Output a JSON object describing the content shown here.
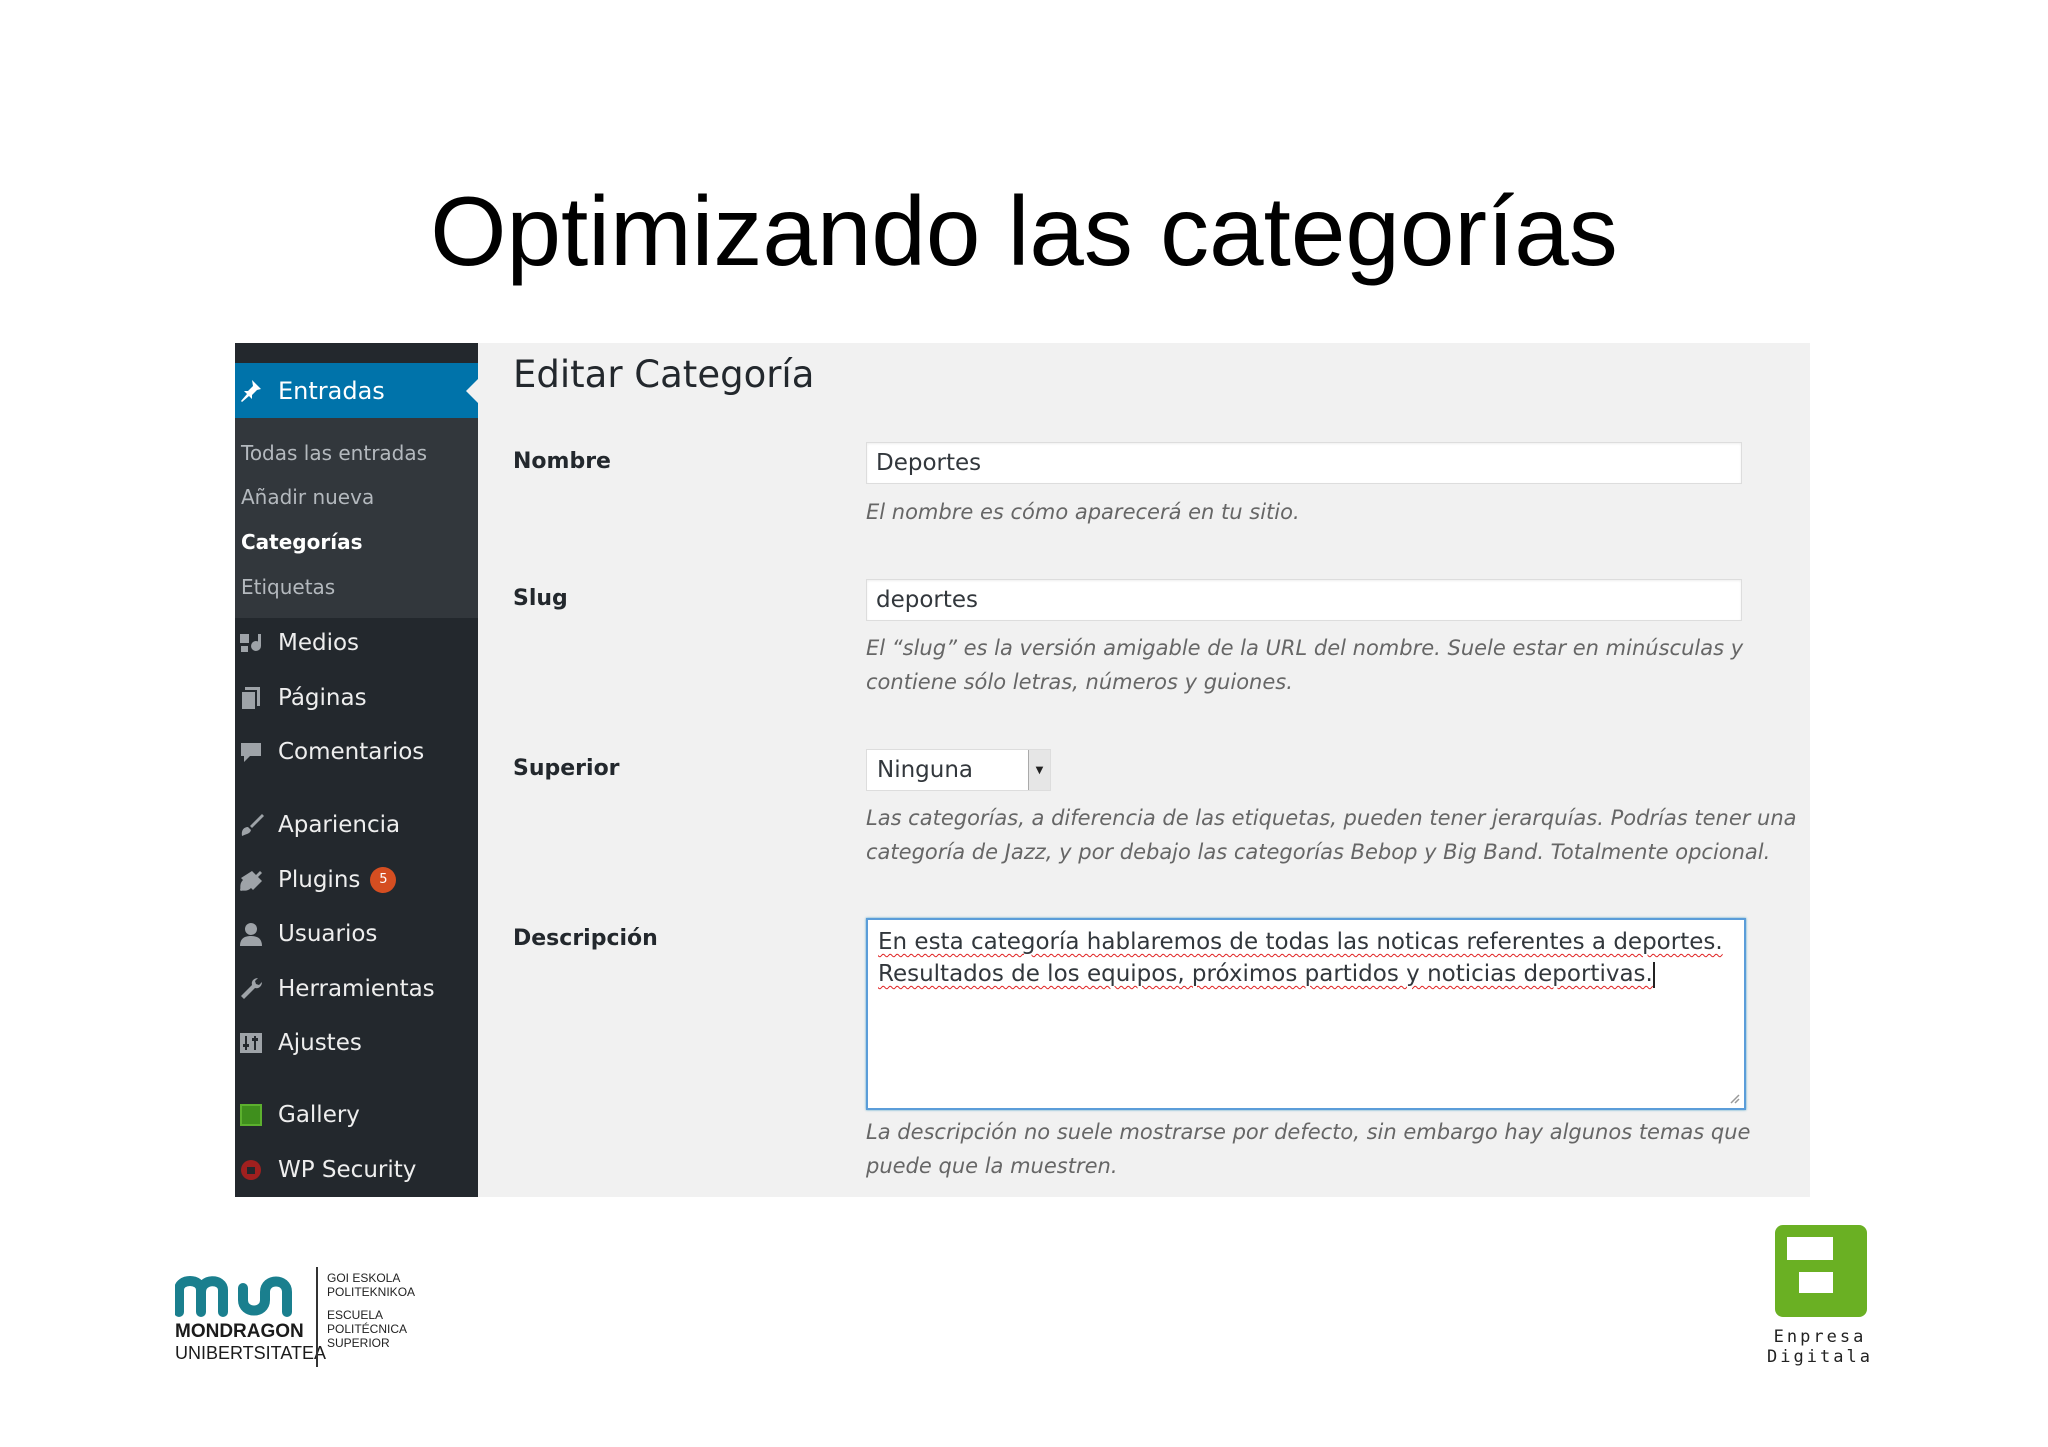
{
  "slide": {
    "title": "Optimizando las categorías"
  },
  "sidebar": {
    "active": {
      "label": "Entradas",
      "icon": "pin-icon"
    },
    "submenu": [
      {
        "label": "Todas las entradas",
        "current": false
      },
      {
        "label": "Añadir nueva",
        "current": false
      },
      {
        "label": "Categorías",
        "current": true
      },
      {
        "label": "Etiquetas",
        "current": false
      }
    ],
    "items": [
      {
        "label": "Medios",
        "icon": "media-icon"
      },
      {
        "label": "Páginas",
        "icon": "pages-icon"
      },
      {
        "label": "Comentarios",
        "icon": "comments-icon"
      },
      {
        "label": "Apariencia",
        "icon": "appearance-icon"
      },
      {
        "label": "Plugins",
        "icon": "plugins-icon",
        "badge": "5"
      },
      {
        "label": "Usuarios",
        "icon": "users-icon"
      },
      {
        "label": "Herramientas",
        "icon": "tools-icon"
      },
      {
        "label": "Ajustes",
        "icon": "settings-icon"
      },
      {
        "label": "Gallery",
        "icon": "gallery-icon"
      },
      {
        "label": "WP Security",
        "icon": "security-icon"
      }
    ],
    "colors": {
      "bg": "#23282d",
      "submenu_bg": "#32373c",
      "active_bg": "#0073aa",
      "badge": "#d54e21"
    }
  },
  "form": {
    "page_title": "Editar Categoría",
    "nombre": {
      "label": "Nombre",
      "value": "Deportes",
      "help": "El nombre es cómo aparecerá en tu sitio."
    },
    "slug": {
      "label": "Slug",
      "value": "deportes",
      "help": "El “slug” es la versión amigable de la URL del nombre. Suele estar en minúsculas y contiene sólo letras, números y guiones."
    },
    "superior": {
      "label": "Superior",
      "value": "Ninguna",
      "help": "Las categorías, a diferencia de las etiquetas, pueden tener jerarquías. Podrías tener una categoría de Jazz, y por debajo las categorías Bebop y Big Band. Totalmente opcional."
    },
    "descripcion": {
      "label": "Descripción",
      "line1": "En esta categoría hablaremos de todas las noticas referentes a deportes.",
      "line2": "Resultados de los equipos, próximos partidos y noticias deportivas.",
      "help": "La descripción no suele mostrarse por defecto, sin embargo hay algunos temas que puede que la muestren."
    }
  },
  "footer": {
    "mondragon": {
      "line1": "MONDRAGON",
      "line2": "UNIBERTSITATEA",
      "side1": "GOI ESKOLA",
      "side2": "POLITEKNIKOA",
      "side3": "ESCUELA",
      "side4": "POLITÉCNICA",
      "side5": "SUPERIOR",
      "color": "#1a7f8e"
    },
    "enpresa": {
      "line1": "Enpresa",
      "line2": "Digitala",
      "color": "#6ab023"
    }
  }
}
